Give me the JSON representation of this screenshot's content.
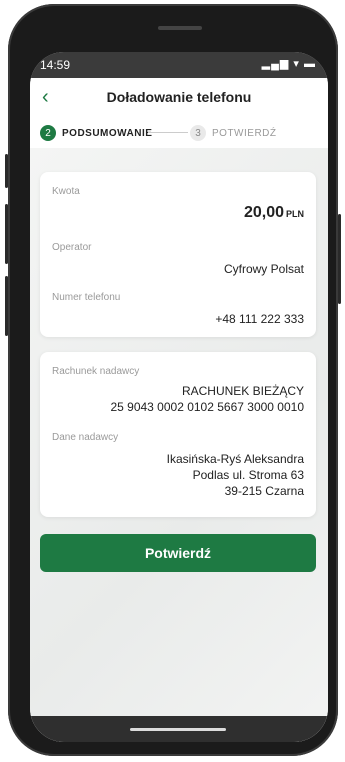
{
  "status": {
    "time": "14:59",
    "icons": "▂▄▆ ▾ ▬"
  },
  "header": {
    "back_icon": "chevron-left-icon",
    "title": "Doładowanie telefonu"
  },
  "steps": [
    {
      "number": "2",
      "label": "PODSUMOWANIE"
    },
    {
      "number": "3",
      "label": "POTWIERDŹ"
    }
  ],
  "summary": {
    "amount_label": "Kwota",
    "amount_value": "20,00",
    "amount_currency": "PLN",
    "operator_label": "Operator",
    "operator_value": "Cyfrowy Polsat",
    "phone_label": "Numer telefonu",
    "phone_value": "+48 111 222 333"
  },
  "sender": {
    "account_label": "Rachunek nadawcy",
    "account_name": "RACHUNEK BIEŻĄCY",
    "account_number": "25 9043 0002 0102 5667 3000 0010",
    "data_label": "Dane nadawcy",
    "name": "Ikasińska-Ryś Aleksandra",
    "address1": "Podlas ul. Stroma 63",
    "address2": "39-215 Czarna"
  },
  "confirm_label": "Potwierdź",
  "colors": {
    "accent": "#1e7a43"
  }
}
